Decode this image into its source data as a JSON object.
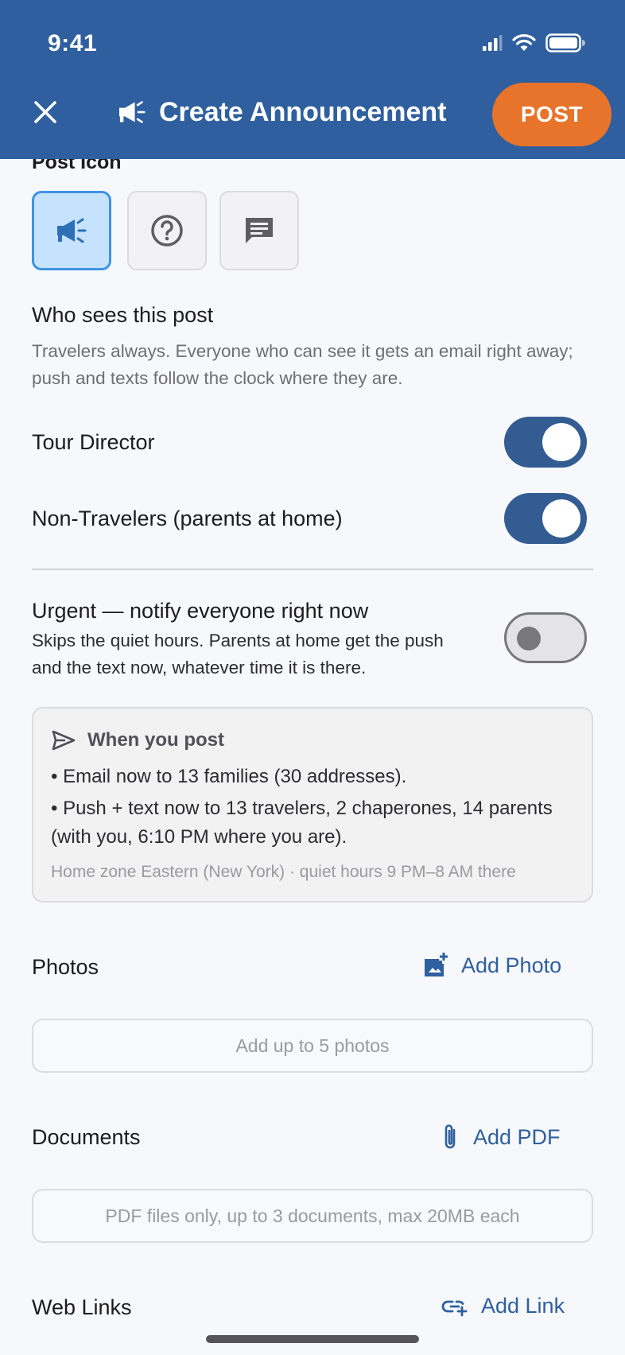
{
  "status_bar": {
    "time": "9:41"
  },
  "header": {
    "title": "Create Announcement",
    "post_label": "POST"
  },
  "post_icon": {
    "label": "Post Icon",
    "options": [
      {
        "icon": "megaphone-icon",
        "selected": true
      },
      {
        "icon": "question-circle-icon",
        "selected": false
      },
      {
        "icon": "chat-message-icon",
        "selected": false
      }
    ]
  },
  "audience": {
    "title": "Who sees this post",
    "description": "Travelers always. Everyone who can see it gets an email right away; push and texts follow the clock where they are.",
    "toggles": [
      {
        "label": "Tour Director",
        "on": true
      },
      {
        "label": "Non-Travelers (parents at home)",
        "on": true
      }
    ]
  },
  "urgent": {
    "title": "Urgent — notify everyone right now",
    "description": "Skips the quiet hours. Parents at home get the push and the text now, whatever time it is there.",
    "on": false
  },
  "when_you_post": {
    "title": "When you post",
    "bullets": [
      "• Email now to 13 families (30 addresses).",
      "• Push + text now to 13 travelers, 2 chaperones, 14 parents (with you, 6:10 PM where you are)."
    ],
    "footer": "Home zone Eastern (New York) · quiet hours 9 PM–8 AM there"
  },
  "photos": {
    "label": "Photos",
    "action": "Add Photo",
    "placeholder": "Add up to 5 photos"
  },
  "documents": {
    "label": "Documents",
    "action": "Add PDF",
    "placeholder": "PDF files only, up to 3 documents, max 20MB each"
  },
  "links": {
    "label": "Web Links",
    "action": "Add Link"
  },
  "colors": {
    "header": "#2f5f9e",
    "accent": "#e8742b",
    "toggle_on": "#335c92",
    "link": "#2f5f9e"
  }
}
